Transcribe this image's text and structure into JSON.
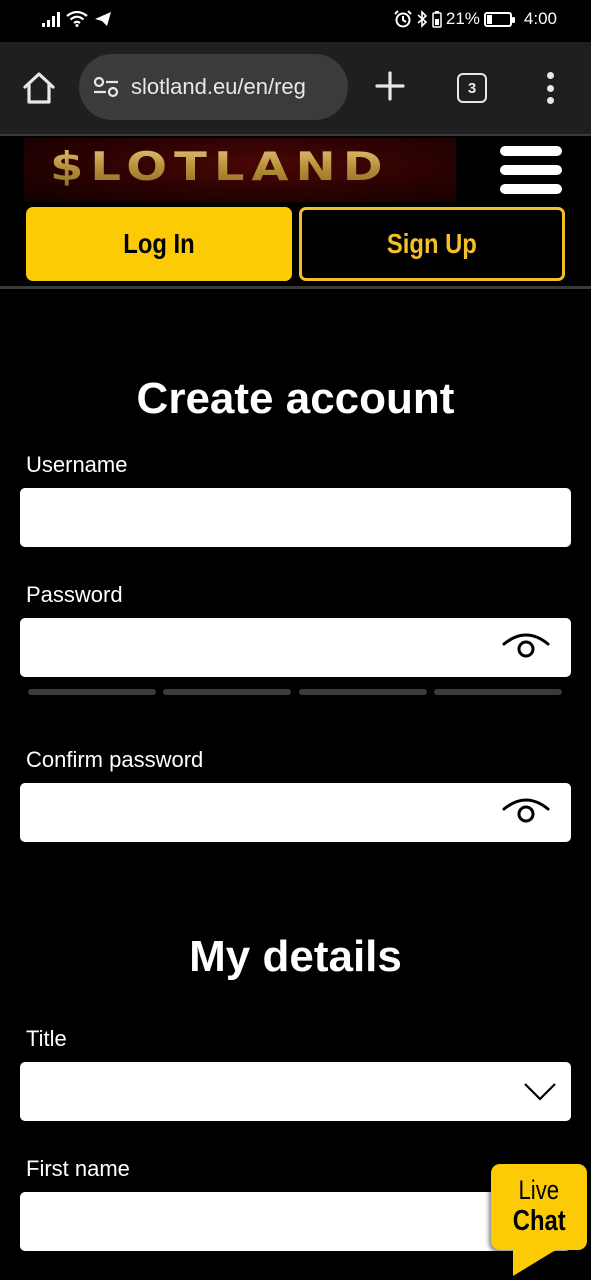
{
  "status_bar": {
    "battery_percent": "21%",
    "time": "4:00",
    "icons": [
      "signal-icon",
      "wifi-icon",
      "telegram-icon",
      "alarm-icon",
      "bluetooth-icon",
      "battery-saver-icon",
      "battery-icon"
    ]
  },
  "browser": {
    "url": "slotland.eu/en/reg",
    "tab_count": "3",
    "icons": [
      "home-icon",
      "site-settings-icon",
      "new-tab-icon",
      "tabs-icon",
      "menu-icon"
    ]
  },
  "header": {
    "logo_text": "$LOTLAND",
    "login_label": "Log In",
    "signup_label": "Sign Up",
    "colors": {
      "accent": "#fccb06",
      "accent_outline": "#f3c02b",
      "background": "#000000"
    }
  },
  "form": {
    "create_account_title": "Create account",
    "username": {
      "label": "Username",
      "value": "",
      "placeholder": ""
    },
    "password": {
      "label": "Password",
      "value": "",
      "placeholder": "",
      "strength_segments": 4,
      "strength_filled": 0
    },
    "confirm_password": {
      "label": "Confirm password",
      "value": "",
      "placeholder": ""
    },
    "my_details_title": "My details",
    "title": {
      "label": "Title",
      "selected": ""
    },
    "first_name": {
      "label": "First name",
      "value": "",
      "placeholder": ""
    }
  },
  "live_chat": {
    "line1": "Live",
    "line2": "Chat"
  }
}
